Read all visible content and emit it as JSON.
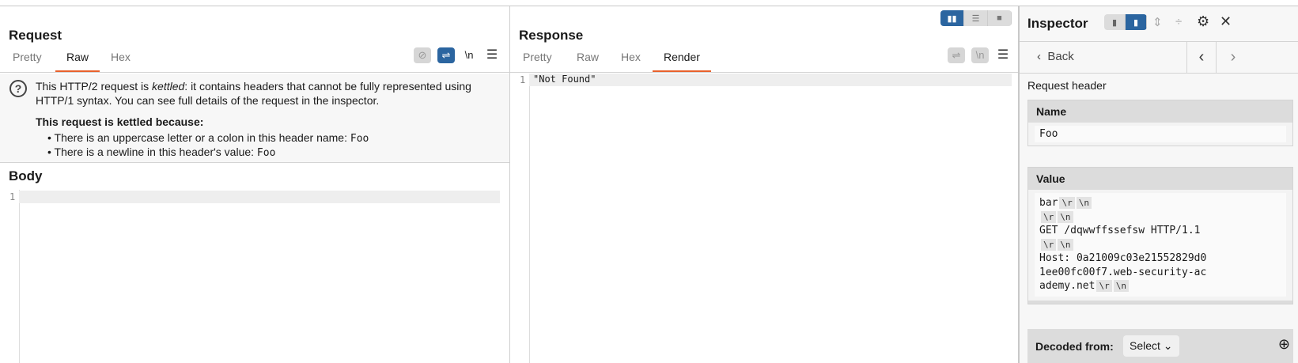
{
  "request": {
    "title": "Request",
    "tabs": [
      "Pretty",
      "Raw",
      "Hex"
    ],
    "active_tab": "Raw",
    "newline_label": "\\n",
    "kettle": {
      "intro_pre": "This HTTP/2 request is ",
      "intro_em": "kettled",
      "intro_post": ": it contains headers that cannot be fully represented using HTTP/1 syntax. You can see full details of the request in the inspector.",
      "because": "This request is kettled because:",
      "reasons": [
        {
          "text": "There is an uppercase letter or a colon in this header name: ",
          "code": "Foo"
        },
        {
          "text": "There is a newline in this header's value: ",
          "code": "Foo"
        }
      ]
    },
    "body_title": "Body",
    "body_lines": [
      "1"
    ]
  },
  "response": {
    "title": "Response",
    "tabs": [
      "Pretty",
      "Raw",
      "Hex",
      "Render"
    ],
    "active_tab": "Render",
    "newline_label": "\\n",
    "line_number": "1",
    "content": "\"Not Found\""
  },
  "inspector": {
    "title": "Inspector",
    "back_label": "Back",
    "section": "Request header",
    "name_label": "Name",
    "name_value": "Foo",
    "value_label": "Value",
    "value_lines": [
      {
        "text": "bar",
        "esc": [
          "\\r",
          "\\n"
        ]
      },
      {
        "text": "",
        "esc": [
          "\\r",
          "\\n"
        ]
      },
      {
        "text": "GET /dqwwffssefsw HTTP/1.1",
        "esc": []
      },
      {
        "text": "",
        "esc": [
          "\\r",
          "\\n"
        ]
      },
      {
        "text": "Host: 0a21009c03e21552829d0",
        "esc": []
      },
      {
        "text": "1ee00fc00f7.web-security-ac",
        "esc": []
      },
      {
        "text": "ademy.net",
        "esc": [
          "\\r",
          "\\n"
        ]
      }
    ],
    "decoded_label": "Decoded from:",
    "decoded_select": "Select"
  },
  "colors": {
    "accent": "#2b65a0",
    "tab_underline": "#e8612c"
  }
}
